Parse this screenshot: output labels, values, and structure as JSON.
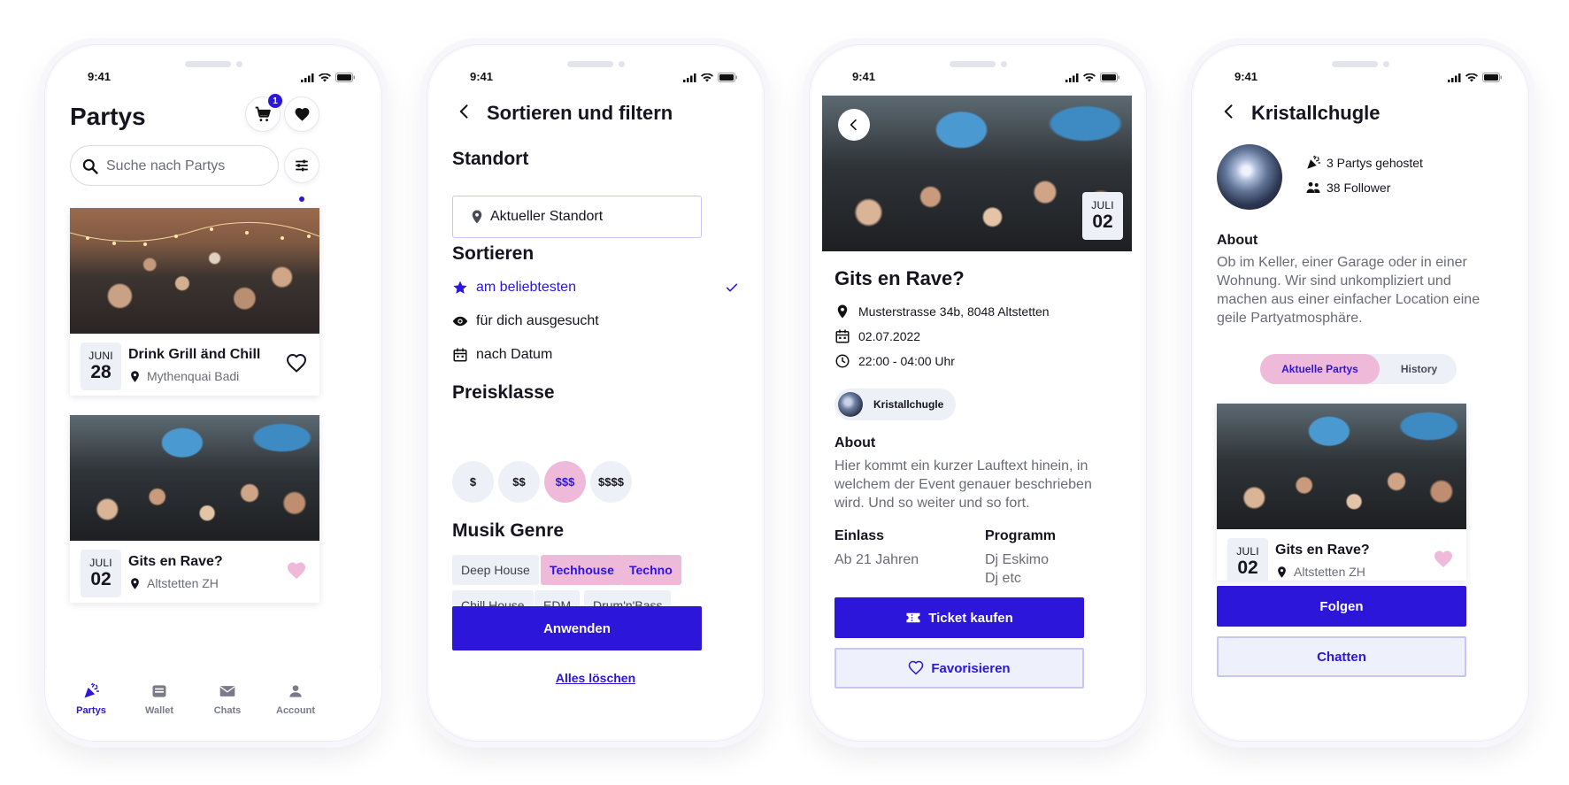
{
  "status": {
    "time": "9:41"
  },
  "colors": {
    "primary": "#2b16d9",
    "pink": "#efb9da",
    "chip": "#eef0f7"
  },
  "screen1": {
    "title": "Partys",
    "cart_badge": "1",
    "search_placeholder": "Suche nach Partys",
    "cards": [
      {
        "month": "JUNI",
        "day": "28",
        "title": "Drink Grill änd Chill",
        "location": "Mythenquai Badi",
        "favorited": false
      },
      {
        "month": "JULI",
        "day": "02",
        "title": "Gits en Rave?",
        "location": "Altstetten ZH",
        "favorited": true
      }
    ],
    "tabs": [
      {
        "label": "Partys",
        "icon": "party-popper-icon",
        "active": true
      },
      {
        "label": "Wallet",
        "icon": "wallet-icon",
        "active": false
      },
      {
        "label": "Chats",
        "icon": "mail-icon",
        "active": false
      },
      {
        "label": "Account",
        "icon": "person-icon",
        "active": false
      }
    ]
  },
  "screen2": {
    "title": "Sortieren und filtern",
    "location_heading": "Standort",
    "location_value": "Aktueller Standort",
    "sort_heading": "Sortieren",
    "sort_options": [
      {
        "label": "am beliebtesten",
        "icon": "star-icon",
        "selected": true
      },
      {
        "label": "für dich ausgesucht",
        "icon": "eye-icon",
        "selected": false
      },
      {
        "label": "nach Datum",
        "icon": "calendar-icon",
        "selected": false
      }
    ],
    "price_heading": "Preisklasse",
    "prices": [
      {
        "label": "$",
        "selected": false
      },
      {
        "label": "$$",
        "selected": false
      },
      {
        "label": "$$$",
        "selected": true
      },
      {
        "label": "$$$$",
        "selected": false
      }
    ],
    "genre_heading": "Musik Genre",
    "genres": [
      {
        "label": "Deep House",
        "selected": false
      },
      {
        "label": "Techhouse",
        "selected": true
      },
      {
        "label": "Techno",
        "selected": true
      },
      {
        "label": "Chill House",
        "selected": false
      },
      {
        "label": "EDM",
        "selected": false
      },
      {
        "label": "Drum'n'Bass",
        "selected": false
      }
    ],
    "apply_label": "Anwenden",
    "clear_label": "Alles löschen"
  },
  "screen3": {
    "hero_month": "JULI",
    "hero_day": "02",
    "title": "Gits en Rave?",
    "address": "Musterstrasse 34b, 8048 Altstetten",
    "date": "02.07.2022",
    "time": "22:00 - 04:00 Uhr",
    "host": "Kristallchugle",
    "about_heading": "About",
    "about_text": "Hier kommt ein kurzer Lauftext hinein, in welchem der Event genauer beschrieben wird. Und so weiter und so fort.",
    "entry_heading": "Einlass",
    "entry_value": "Ab 21 Jahren",
    "program_heading": "Programm",
    "program_line1": "Dj Eskimo",
    "program_line2": "Dj etc",
    "ticket_label": "Ticket kaufen",
    "favorite_label": "Favorisieren"
  },
  "screen4": {
    "title": "Kristallchugle",
    "parties_hosted": "3 Partys gehostet",
    "followers": "38 Follower",
    "about_heading": "About",
    "about_text": "Ob im Keller, einer Garage oder in einer Wohnung. Wir sind unkompliziert und machen aus einer einfacher Location eine geile Partyatmosphäre.",
    "segments": [
      {
        "label": "Aktuelle Partys",
        "selected": true
      },
      {
        "label": "History",
        "selected": false
      }
    ],
    "card": {
      "month": "JULI",
      "day": "02",
      "title": "Gits en Rave?",
      "location": "Altstetten ZH"
    },
    "follow_label": "Folgen",
    "chat_label": "Chatten"
  }
}
